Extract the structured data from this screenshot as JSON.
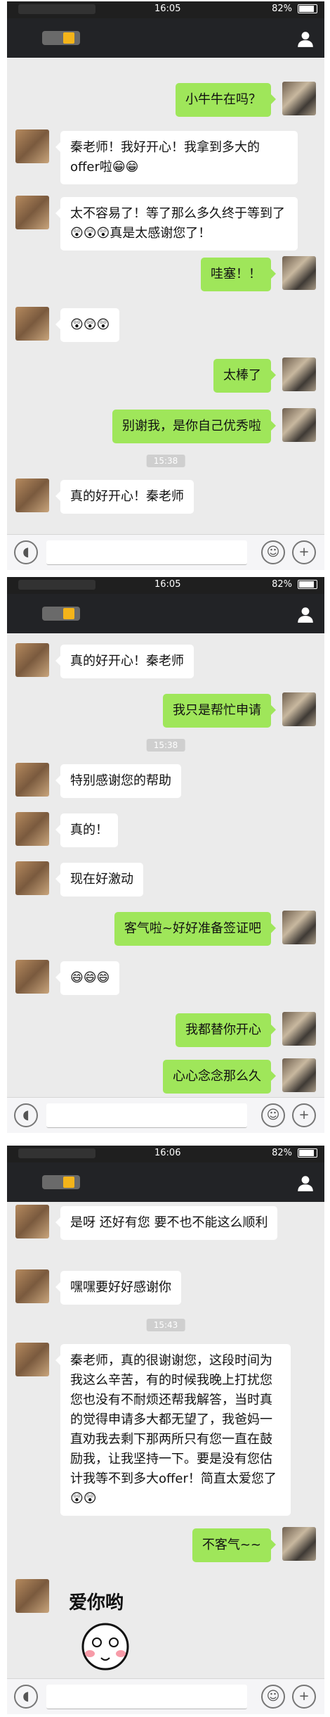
{
  "status": {
    "time1": "16:05",
    "time2": "16:05",
    "time3": "16:06",
    "battery": "82%"
  },
  "icons": {
    "profile": "person-icon",
    "voice": "voice-icon",
    "emoji": "smile-icon",
    "plus": "plus-icon"
  },
  "colors": {
    "bubble_right": "#9fe65a",
    "bubble_left": "#ffffff",
    "background": "#ebebeb",
    "navbar": "#222326"
  },
  "screens": [
    {
      "messages": [
        {
          "side": "right",
          "text": "小牛牛在吗？"
        },
        {
          "side": "left",
          "text": "秦老师！我好开心！我拿到多大的offer啦😁😁"
        },
        {
          "side": "left",
          "text": "太不容易了！等了那么多久终于等到了😲😲😲真是太感谢您了！"
        },
        {
          "side": "right",
          "text": "哇塞！！"
        },
        {
          "side": "left",
          "text": "😲😲😲"
        },
        {
          "side": "right",
          "text": "太棒了"
        },
        {
          "side": "right",
          "text": "别谢我，是你自己优秀啦"
        },
        {
          "side": "time",
          "text": "15:38"
        },
        {
          "side": "left",
          "text": "真的好开心！秦老师"
        }
      ]
    },
    {
      "messages": [
        {
          "side": "left",
          "text": "真的好开心！秦老师"
        },
        {
          "side": "right",
          "text": "我只是帮忙申请"
        },
        {
          "side": "time",
          "text": "15:38"
        },
        {
          "side": "left",
          "text": "特别感谢您的帮助"
        },
        {
          "side": "left",
          "text": "真的！"
        },
        {
          "side": "left",
          "text": "现在好激动"
        },
        {
          "side": "right",
          "text": "客气啦~好好准备签证吧"
        },
        {
          "side": "left",
          "text": "😄😄😄"
        },
        {
          "side": "right",
          "text": "我都替你开心"
        },
        {
          "side": "right",
          "text": "心心念念那么久"
        }
      ]
    },
    {
      "messages": [
        {
          "side": "left",
          "text": "是呀 还好有您 要不也不能这么顺利"
        },
        {
          "side": "left",
          "text": "嘿嘿要好好感谢你"
        },
        {
          "side": "time",
          "text": "15:43"
        },
        {
          "side": "left",
          "text": "秦老师，真的很谢谢您，这段时间为我这么辛苦，有的时候我晚上打扰您您也没有不耐烦还帮我解答，当时真的觉得申请多大都无望了，我爸妈一直劝我去剩下那两所只有您一直在鼓励我，让我坚持一下。要是没有您估计我等不到多大offer！简直太爱您了😲😲"
        },
        {
          "side": "right",
          "text": "不客气~~"
        },
        {
          "side": "left",
          "text": "爱你哟"
        }
      ]
    }
  ]
}
